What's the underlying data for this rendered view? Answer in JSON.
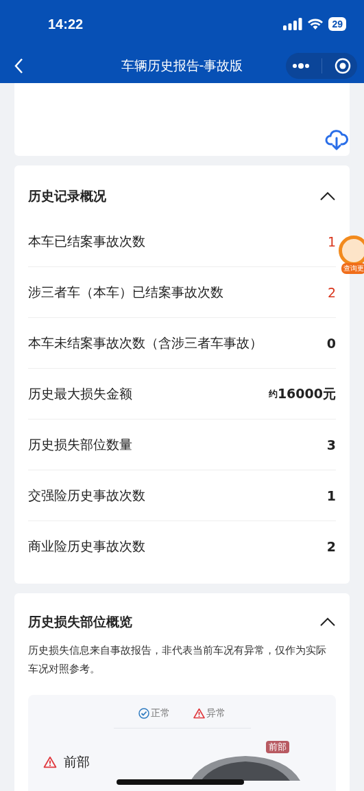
{
  "status_bar": {
    "time": "14:22",
    "battery": "29"
  },
  "nav": {
    "title": "车辆历史报告-事故版"
  },
  "float_badge": {
    "label": "查询更"
  },
  "overview": {
    "title": "历史记录概况",
    "expanded": true,
    "rows": [
      {
        "label": "本车已结案事故次数",
        "value": "1",
        "highlight": true
      },
      {
        "label": "涉三者车（本车）已结案事故次数",
        "value": "2",
        "highlight": true
      },
      {
        "label": "本车未结案事故次数（含涉三者车事故）",
        "value": "0",
        "highlight": false
      },
      {
        "label": "历史最大损失金额",
        "prefix": "约",
        "value": "16000元",
        "highlight": false
      },
      {
        "label": "历史损失部位数量",
        "value": "3",
        "highlight": false
      },
      {
        "label": "交强险历史事故次数",
        "value": "1",
        "highlight": false
      },
      {
        "label": "商业险历史事故次数",
        "value": "2",
        "highlight": false
      }
    ]
  },
  "damage": {
    "title": "历史损失部位概览",
    "expanded": true,
    "description": "历史损失信息来自事故报告，非代表当前车况有异常，仅作为实际车况对照参考。",
    "legend": [
      {
        "label": "正常",
        "kind": "normal"
      },
      {
        "label": "异常",
        "kind": "abnormal"
      }
    ],
    "parts": [
      {
        "label": "前部",
        "kind": "abnormal"
      }
    ],
    "car_tag": "前部"
  }
}
